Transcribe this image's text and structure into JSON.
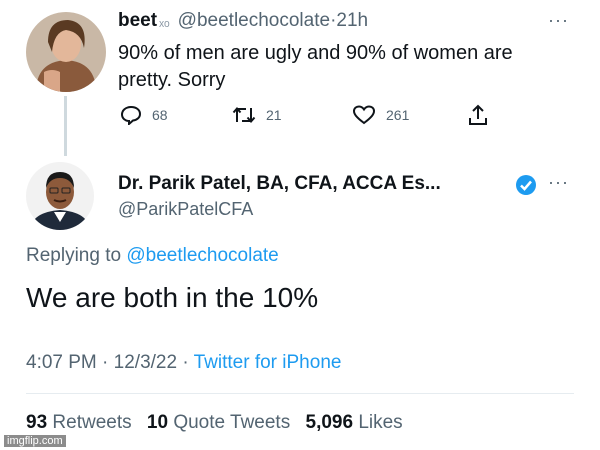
{
  "tweet1": {
    "name": "beet",
    "name_symbol": "ₓₒ",
    "handle": "@beetlechocolate",
    "separator": "·",
    "time": "21h",
    "text": "90% of men are ugly and 90% of women are pretty. Sorry",
    "reply_count": "68",
    "retweet_count": "21",
    "like_count": "261",
    "icons": {
      "reply": "reply-icon",
      "retweet": "retweet-icon",
      "like": "heart-icon",
      "share": "share-icon",
      "more": "more-icon"
    }
  },
  "tweet2": {
    "name": "Dr. Parik Patel, BA, CFA, ACCA Es...",
    "handle": "@ParikPatelCFA",
    "verified_color": "#1d9bf0",
    "replying_prefix": "Replying to",
    "replying_handle": "@beetlechocolate",
    "text": "We are both in the 10%",
    "time": "4:07 PM",
    "dot": "·",
    "date": "12/3/22",
    "source": "Twitter for iPhone",
    "stats": {
      "retweets": "93",
      "retweets_label": "Retweets",
      "quotes": "10",
      "quotes_label": "Quote Tweets",
      "likes": "5,096",
      "likes_label": "Likes"
    }
  },
  "watermark": "imgflip.com",
  "colors": {
    "link": "#1d9bf0",
    "muted": "#536471",
    "text": "#0f1419"
  }
}
